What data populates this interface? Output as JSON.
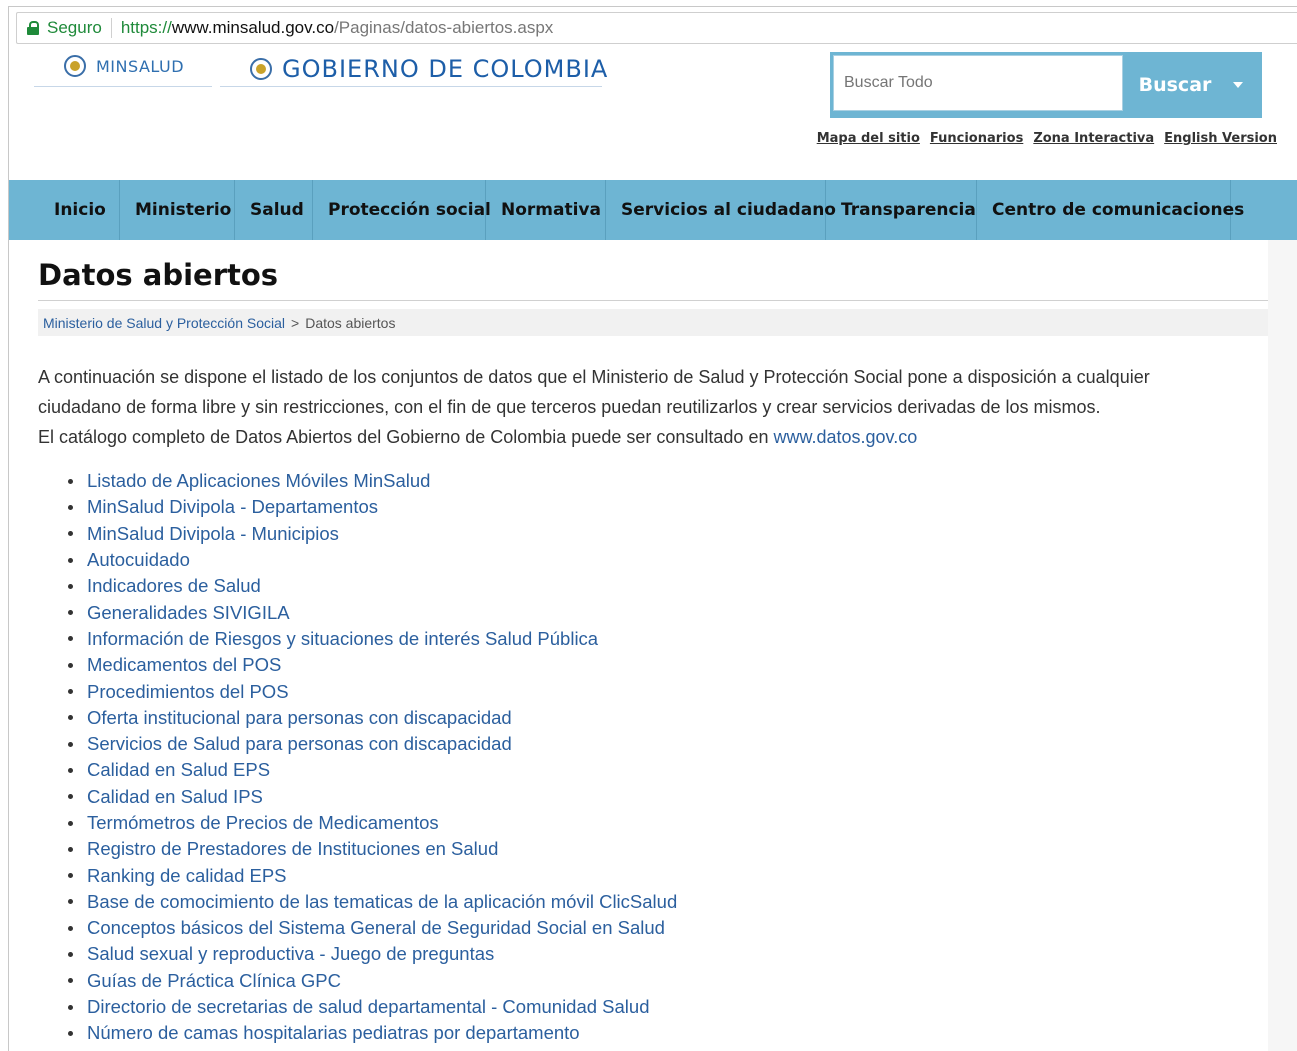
{
  "browser": {
    "secure_label": "Seguro",
    "url_protocol": "https://",
    "url_host": "www.minsalud.gov.co",
    "url_path": "/Paginas/datos-abiertos.aspx"
  },
  "header": {
    "logo_minsalud": "MINSALUD",
    "logo_gobierno": "GOBIERNO DE COLOMBIA",
    "search_placeholder": "Buscar Todo",
    "search_button": "Buscar",
    "utility_links": [
      "Mapa del sitio",
      "Funcionarios",
      "Zona Interactiva",
      "English Version"
    ]
  },
  "nav": {
    "items": [
      "Inicio",
      "Ministerio",
      "Salud",
      "Protección social",
      "Normativa",
      "Servicios al ciudadano",
      "Transparencia",
      "Centro de comunicaciones"
    ]
  },
  "page": {
    "title": "Datos abiertos",
    "breadcrumb_parent": "Ministerio de Salud y Protección Social",
    "breadcrumb_sep": ">",
    "breadcrumb_current": "Datos abiertos",
    "intro_line1": "A continuación se dispone el listado de los conjuntos de datos que el  Ministerio de Salud y Protección Social pone a disposición a cualquier",
    "intro_line2": "ciudadano de forma libre y sin restricciones, con el fin de que terceros puedan reutilizarlos y crear servicios derivadas de los mismos.",
    "intro_line3": "El catálogo completo de Datos Abiertos del Gobierno de Colombia puede ser consultado en ",
    "catalog_link": "www.datos.gov.co"
  },
  "datasets": [
    "Listado de Aplicaciones Móviles MinSalud",
    "MinSalud Divipola - Departamentos",
    "MinSalud Divipola - Municipios",
    "Autocuidado",
    "Indicadores de Salud",
    "Generalidades SIVIGILA",
    "Información de Riesgos y situaciones de interés Salud Pública",
    "Medicamentos del POS",
    "Procedimientos del POS",
    "Oferta institucional para personas con discapacidad",
    "Servicios de Salud para personas con discapacidad",
    "Calidad en Salud EPS",
    "Calidad en Salud IPS",
    "Termómetros de Precios de Medicamentos",
    "Registro de Prestadores de Instituciones en Salud",
    "Ranking de calidad EPS",
    "Base de comocimiento de las tematicas de la aplicación móvil ClicSalud",
    "Conceptos básicos del Sistema General de Seguridad Social en Salud",
    "Salud sexual y reproductiva - Juego de preguntas",
    "Guías de Práctica Clínica GPC",
    "Directorio de secretarias de salud departamental - Comunidad Salud",
    "Número de camas hospitalarias pediatras por departamento"
  ],
  "colors": {
    "nav_bg": "#6eb5d3",
    "link": "#2b5f9e",
    "secure": "#1f8a3a"
  }
}
